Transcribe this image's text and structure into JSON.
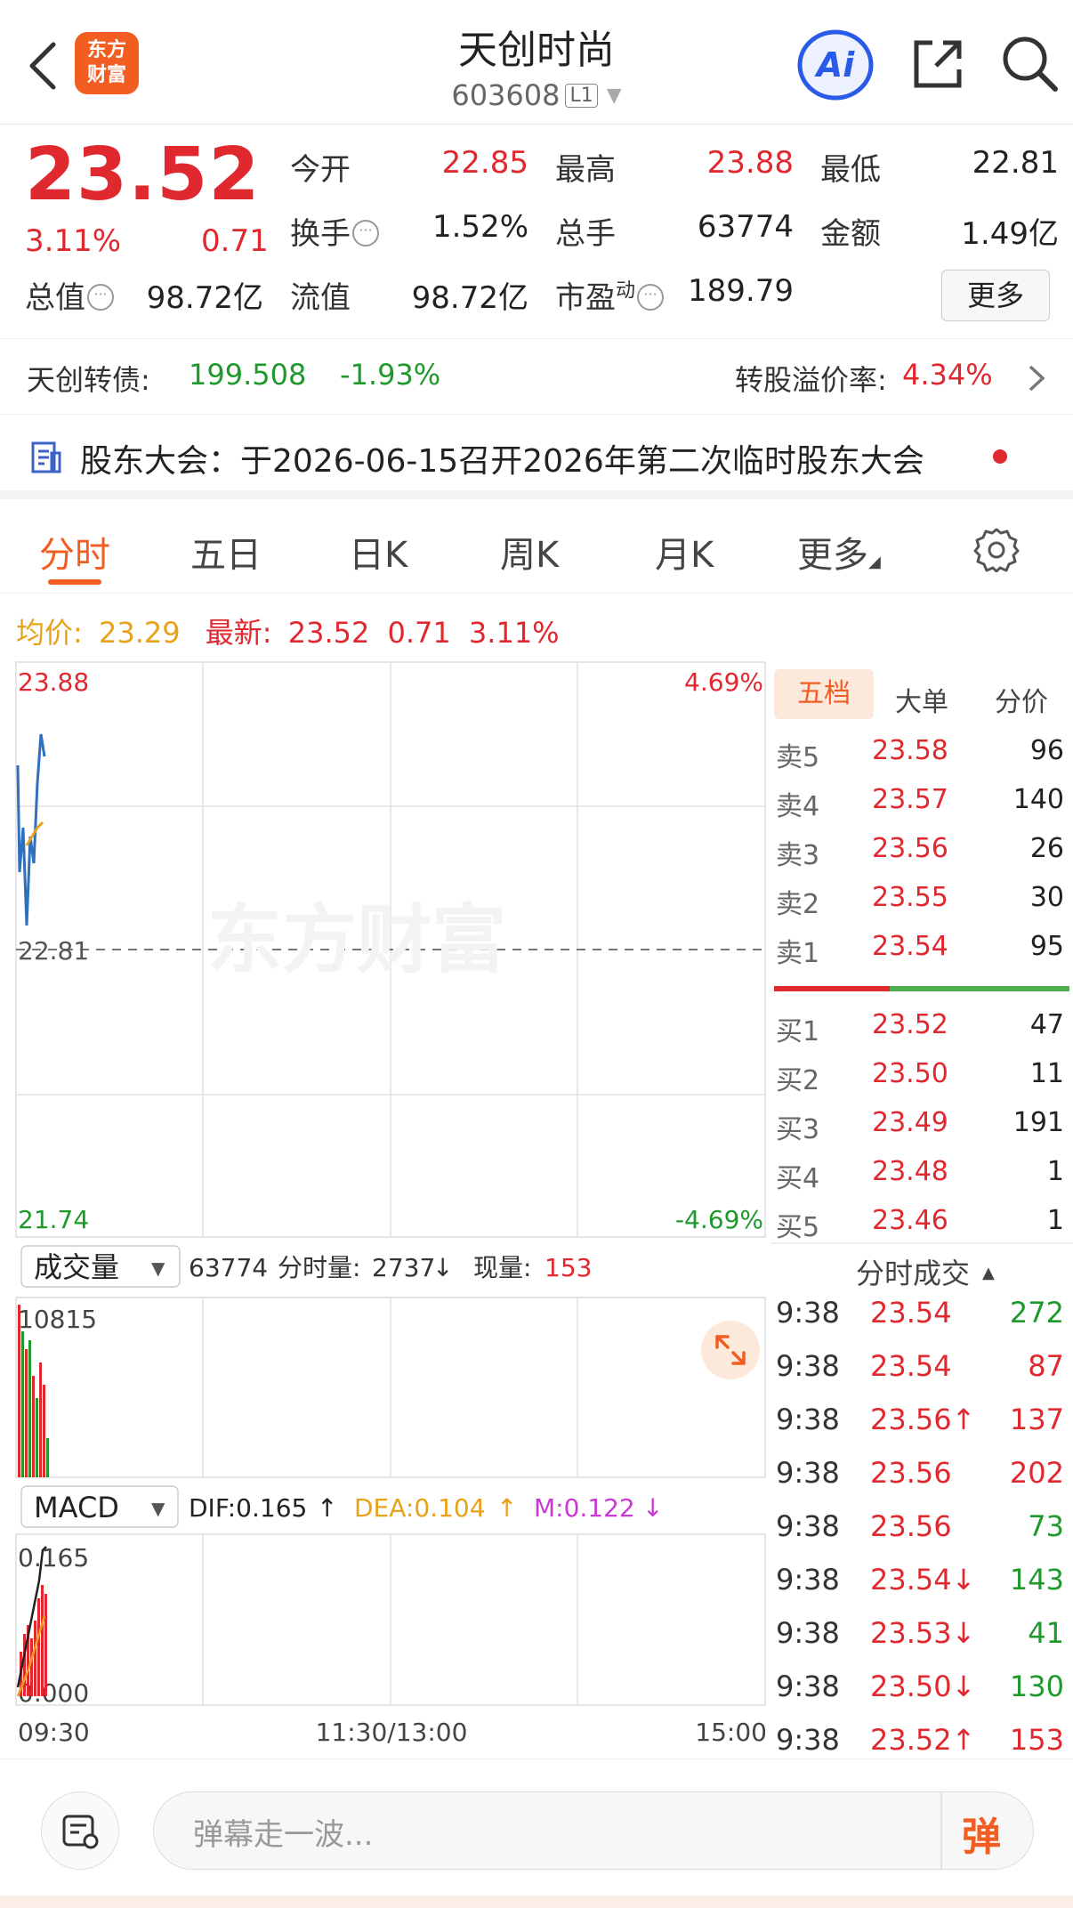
{
  "header": {
    "logo_text_1": "东方",
    "logo_text_2": "财富",
    "stock_name": "天创时尚",
    "stock_code": "603608",
    "level_badge": "L1",
    "ai_label": "Ai"
  },
  "quote": {
    "last_price": "23.52",
    "change_pct": "3.11%",
    "change_amt": "0.71",
    "fields": {
      "open_label": "今开",
      "open": "22.85",
      "high_label": "最高",
      "high": "23.88",
      "low_label": "最低",
      "low": "22.81",
      "turnover_rate_label": "换手",
      "turnover_rate": "1.52%",
      "volume_label": "总手",
      "volume": "63774",
      "amount_label": "金额",
      "amount": "1.49亿",
      "mktcap_label": "总值",
      "mktcap": "98.72亿",
      "float_label": "流值",
      "float_cap": "98.72亿",
      "pe_label": "市盈",
      "pe_sup": "动",
      "pe": "189.79"
    },
    "more_label": "更多"
  },
  "bond": {
    "name": "天创转债:",
    "price": "199.508",
    "change": "-1.93%",
    "premium_label": "转股溢价率:",
    "premium": "4.34%"
  },
  "notice": {
    "text": "股东大会：于2026-06-15召开2026年第二次临时股东大会"
  },
  "tabs": {
    "t1": "分时",
    "t2": "五日",
    "t3": "日K",
    "t4": "周K",
    "t5": "月K",
    "t6": "更多"
  },
  "summary": {
    "avg_label": "均价:",
    "avg": "23.29",
    "latest_label": "最新:",
    "latest": "23.52",
    "chg": "0.71",
    "pct": "3.11%"
  },
  "chart_data": {
    "type": "line",
    "price_axis": {
      "top": "23.88",
      "mid": "22.81",
      "bottom": "21.74",
      "top_pct": "4.69%",
      "bottom_pct": "-4.69%"
    },
    "watermark": "东方财富",
    "volume": {
      "selector": "成交量",
      "total": "63774",
      "bar_label": "分时量:",
      "bar_value": "2737",
      "now_label": "现量:",
      "now_value": "153",
      "max_label": "10815"
    },
    "macd": {
      "selector": "MACD",
      "dif": "DIF:0.165",
      "dea": "DEA:0.104",
      "m": "M:0.122",
      "top_label": "0.165",
      "zero_label": "0.000"
    },
    "time_labels": {
      "start": "09:30",
      "mid": "11:30/13:00",
      "end": "15:00"
    }
  },
  "order_book": {
    "tabs": {
      "five": "五档",
      "big": "大单",
      "price": "分价"
    },
    "asks": [
      {
        "label": "卖5",
        "price": "23.58",
        "vol": "96"
      },
      {
        "label": "卖4",
        "price": "23.57",
        "vol": "140"
      },
      {
        "label": "卖3",
        "price": "23.56",
        "vol": "26"
      },
      {
        "label": "卖2",
        "price": "23.55",
        "vol": "30"
      },
      {
        "label": "卖1",
        "price": "23.54",
        "vol": "95"
      }
    ],
    "bids": [
      {
        "label": "买1",
        "price": "23.52",
        "vol": "47"
      },
      {
        "label": "买2",
        "price": "23.50",
        "vol": "11"
      },
      {
        "label": "买3",
        "price": "23.49",
        "vol": "191"
      },
      {
        "label": "买4",
        "price": "23.48",
        "vol": "1"
      },
      {
        "label": "买5",
        "price": "23.46",
        "vol": "1"
      }
    ]
  },
  "ticks": {
    "title": "分时成交",
    "rows": [
      {
        "time": "9:38",
        "price": "23.54",
        "vol": "272",
        "dir": "buy"
      },
      {
        "time": "9:38",
        "price": "23.54",
        "vol": "87",
        "dir": "sell"
      },
      {
        "time": "9:38",
        "price": "23.56↑",
        "vol": "137",
        "dir": "sell"
      },
      {
        "time": "9:38",
        "price": "23.56",
        "vol": "202",
        "dir": "sell"
      },
      {
        "time": "9:38",
        "price": "23.56",
        "vol": "73",
        "dir": "buy"
      },
      {
        "time": "9:38",
        "price": "23.54↓",
        "vol": "143",
        "dir": "buy"
      },
      {
        "time": "9:38",
        "price": "23.53↓",
        "vol": "41",
        "dir": "buy"
      },
      {
        "time": "9:38",
        "price": "23.50↓",
        "vol": "130",
        "dir": "buy"
      },
      {
        "time": "9:38",
        "price": "23.52↑",
        "vol": "153",
        "dir": "sell"
      }
    ]
  },
  "bottom": {
    "danmu_placeholder": "弹幕走一波...",
    "danmu_button": "弹"
  }
}
